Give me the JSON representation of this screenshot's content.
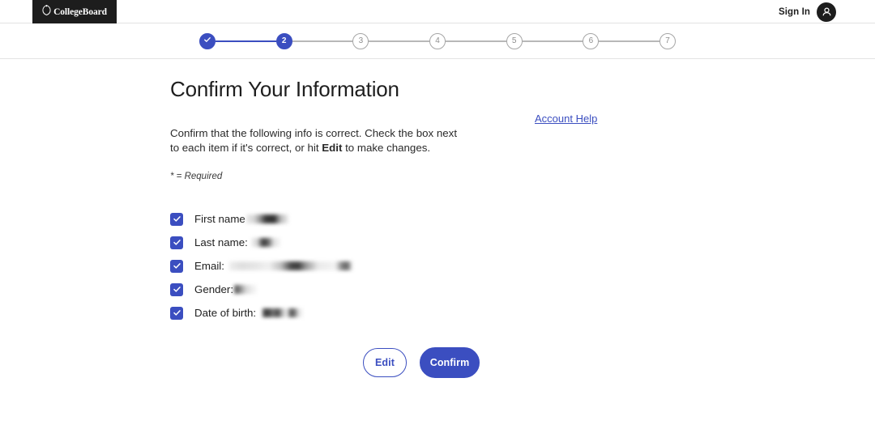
{
  "header": {
    "logo_text": "CollegeBoard",
    "logo_icon": "acorn-icon",
    "sign_in_label": "Sign In",
    "avatar_icon": "user-avatar-icon"
  },
  "stepper": {
    "current_step": 2,
    "total_steps": 7,
    "steps": [
      {
        "label": "1",
        "state": "done",
        "icon": "check-icon"
      },
      {
        "label": "2",
        "state": "active"
      },
      {
        "label": "3",
        "state": "todo"
      },
      {
        "label": "4",
        "state": "todo"
      },
      {
        "label": "5",
        "state": "todo"
      },
      {
        "label": "6",
        "state": "todo"
      },
      {
        "label": "7",
        "state": "todo"
      }
    ]
  },
  "main": {
    "title": "Confirm Your Information",
    "intro_prefix": "Confirm that the following info is correct. Check the box next to each item if it's correct, or hit ",
    "intro_bold": "Edit",
    "intro_suffix": " to make changes.",
    "required_note": "* = Required",
    "account_help_label": "Account Help",
    "items": [
      {
        "label": "First name",
        "value": "",
        "checked": true,
        "redacted_width": 52
      },
      {
        "label": "Last name:",
        "value": "",
        "checked": true,
        "redacted_width": 36
      },
      {
        "label": "Email:",
        "value": "",
        "checked": true,
        "redacted_width": 152
      },
      {
        "label": "Gender:",
        "value": "",
        "checked": true,
        "redacted_width": 28
      },
      {
        "label": "Date of birth:",
        "value": "",
        "checked": true,
        "redacted_width": 50
      }
    ],
    "edit_button_label": "Edit",
    "confirm_button_label": "Confirm"
  },
  "colors": {
    "accent_blue": "#3b4ec0",
    "logo_black": "#1d1d1d",
    "inactive_gray": "#a6a6a6",
    "divider": "#e3e3e3"
  }
}
